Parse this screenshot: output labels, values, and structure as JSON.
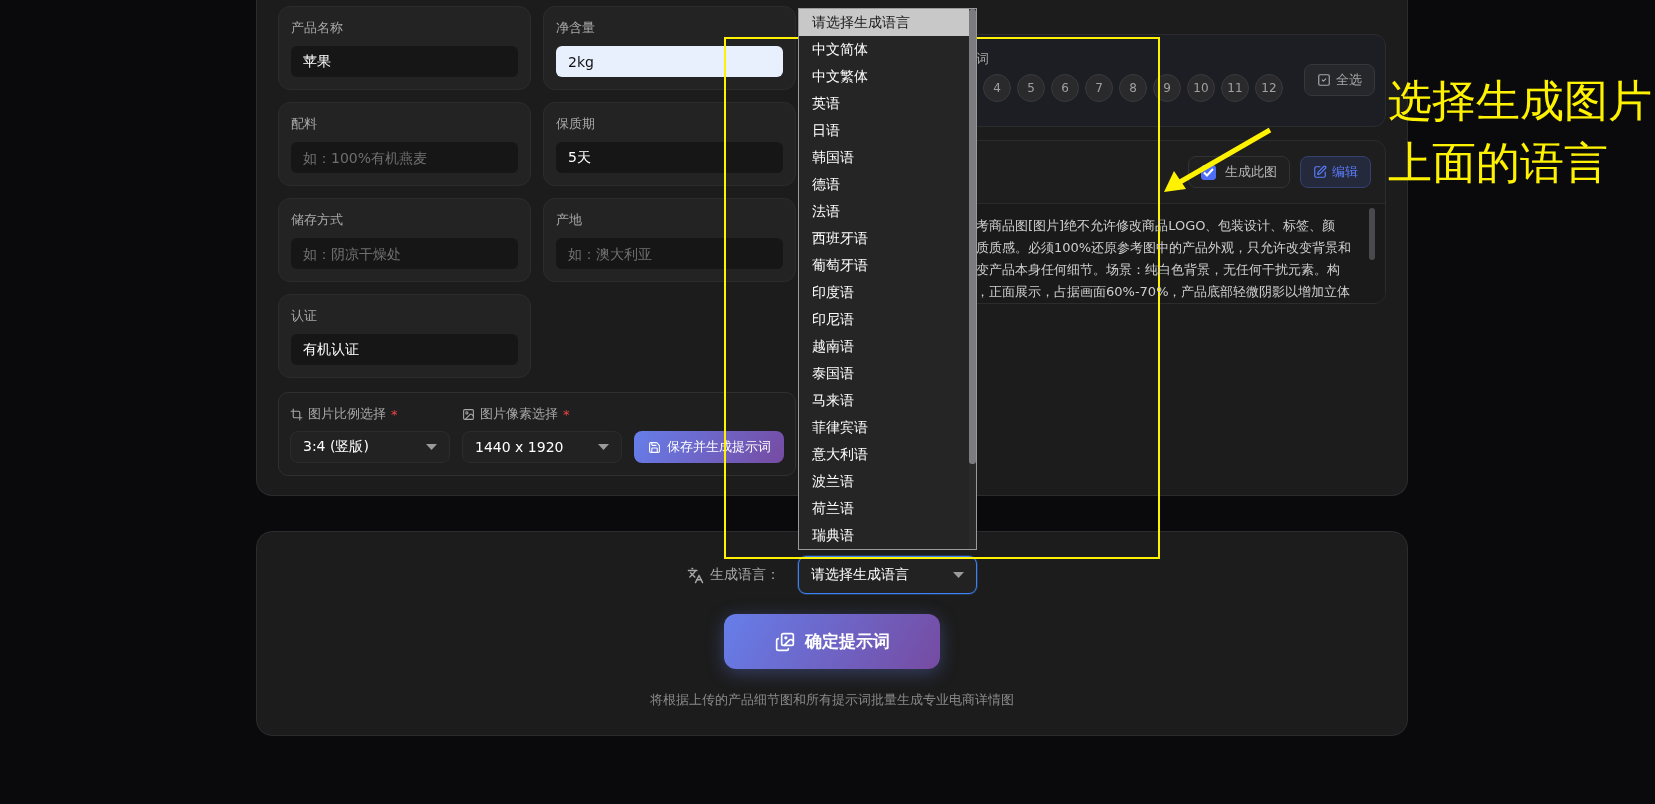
{
  "form_fields": [
    {
      "label": "产品名称",
      "value": "苹果",
      "autofilled": false
    },
    {
      "label": "净含量",
      "value": "2kg",
      "autofilled": true
    },
    {
      "label": "配料",
      "placeholder": "如：100%有机燕麦",
      "autofilled": false
    },
    {
      "label": "保质期",
      "value": "5天",
      "autofilled": false
    },
    {
      "label": "储存方式",
      "placeholder": "如：阴凉干燥处",
      "autofilled": false
    },
    {
      "label": "产地",
      "placeholder": "如：澳大利亚",
      "autofilled": false
    },
    {
      "label": "认证",
      "value": "有机认证",
      "autofilled": false
    }
  ],
  "image_settings": {
    "ratio": {
      "label": "图片比例选择",
      "required_mark": "*",
      "value": "3:4 (竖版)"
    },
    "resolution": {
      "label": "图片像素选择",
      "required_mark": "*",
      "value": "1440 x 1920"
    },
    "save_button": "保存并生成提示词"
  },
  "prompt_selector": {
    "title": "词",
    "numbers": [
      "4",
      "5",
      "6",
      "7",
      "8",
      "9",
      "10",
      "11",
      "12"
    ],
    "select_all": "全选"
  },
  "prompt_card": {
    "generate_label": "生成此图",
    "generate_checked": true,
    "edit_button": "编辑",
    "text_lines": [
      "考商品图[图片]绝不允许修改商品LOGO、包装设计、标签、颜",
      "质质感。必须100%还原参考图中的产品外观，只允许改变背景和",
      "变产品本身任何细节。场景：纯白色背景，无任何干扰元素。构",
      "，正面展示，占据画面60%-70%，产品底部轻微阴影以增加立体"
    ]
  },
  "language": {
    "label": "生成语言：",
    "value": "请选择生成语言",
    "open": true,
    "options": [
      {
        "label": "请选择生成语言",
        "selected": true
      },
      {
        "label": "中文简体",
        "selected": false
      },
      {
        "label": "中文繁体",
        "selected": false
      },
      {
        "label": "英语",
        "selected": false
      },
      {
        "label": "日语",
        "selected": false
      },
      {
        "label": "韩国语",
        "selected": false
      },
      {
        "label": "德语",
        "selected": false
      },
      {
        "label": "法语",
        "selected": false
      },
      {
        "label": "西班牙语",
        "selected": false
      },
      {
        "label": "葡萄牙语",
        "selected": false
      },
      {
        "label": "印度语",
        "selected": false
      },
      {
        "label": "印尼语",
        "selected": false
      },
      {
        "label": "越南语",
        "selected": false
      },
      {
        "label": "泰国语",
        "selected": false
      },
      {
        "label": "马来语",
        "selected": false
      },
      {
        "label": "菲律宾语",
        "selected": false
      },
      {
        "label": "意大利语",
        "selected": false
      },
      {
        "label": "波兰语",
        "selected": false
      },
      {
        "label": "荷兰语",
        "selected": false
      },
      {
        "label": "瑞典语",
        "selected": false
      }
    ]
  },
  "confirm_button": "确定提示词",
  "caption": "将根据上传的产品细节图和所有提示词批量生成专业电商详情图",
  "annotation": {
    "text": "选择生成图片上面的语言"
  }
}
